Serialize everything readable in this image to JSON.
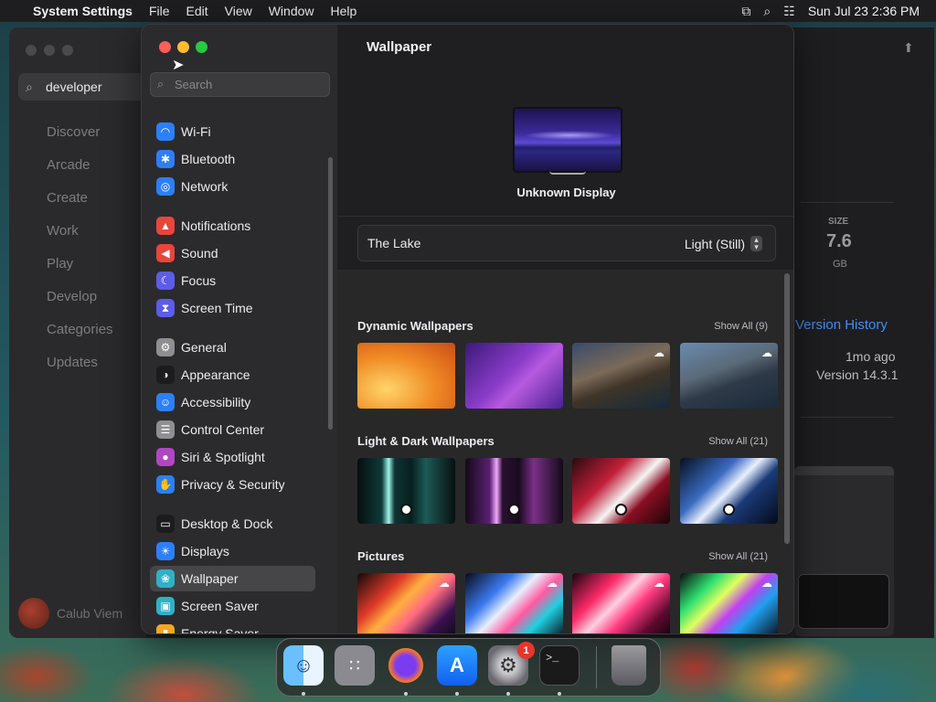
{
  "menubar": {
    "app_name": "System Settings",
    "menus": [
      "File",
      "Edit",
      "View",
      "Window",
      "Help"
    ],
    "datetime": "Sun Jul 23  2:36 PM"
  },
  "appstore": {
    "search_value": "developer",
    "nav": [
      "Discover",
      "Arcade",
      "Create",
      "Work",
      "Play",
      "Develop",
      "Categories",
      "Updates"
    ],
    "user_name": "Calub Viem",
    "size_label": "SIZE",
    "size_value": "7.6",
    "size_unit": "GB",
    "version_history": "Version History",
    "ago": "1mo ago",
    "version": "Version 14.3.1"
  },
  "settings": {
    "search_placeholder": "Search",
    "sidebar": [
      {
        "label": "Wi-Fi",
        "icon": "wifi-icon",
        "color": "#2d7ff9",
        "glyph": "◠"
      },
      {
        "label": "Bluetooth",
        "icon": "bluetooth-icon",
        "color": "#2d7ff9",
        "glyph": "✱"
      },
      {
        "label": "Network",
        "icon": "globe-icon",
        "color": "#2d7ff9",
        "glyph": "◎"
      },
      {
        "label": "Notifications",
        "icon": "bell-icon",
        "color": "#e8453c",
        "glyph": "▲"
      },
      {
        "label": "Sound",
        "icon": "speaker-icon",
        "color": "#e8453c",
        "glyph": "◀"
      },
      {
        "label": "Focus",
        "icon": "moon-icon",
        "color": "#5d5ce6",
        "glyph": "☾"
      },
      {
        "label": "Screen Time",
        "icon": "hourglass-icon",
        "color": "#5d5ce6",
        "glyph": "⧗"
      },
      {
        "label": "General",
        "icon": "gear-icon",
        "color": "#8e8e93",
        "glyph": "⚙"
      },
      {
        "label": "Appearance",
        "icon": "appearance-icon",
        "color": "#1c1c1e",
        "glyph": "◑"
      },
      {
        "label": "Accessibility",
        "icon": "accessibility-icon",
        "color": "#2d7ff9",
        "glyph": "☺"
      },
      {
        "label": "Control Center",
        "icon": "control-center-icon",
        "color": "#8e8e93",
        "glyph": "☰"
      },
      {
        "label": "Siri & Spotlight",
        "icon": "siri-icon",
        "color": "#b146c2",
        "glyph": "●"
      },
      {
        "label": "Privacy & Security",
        "icon": "hand-icon",
        "color": "#2d7ff9",
        "glyph": "✋"
      },
      {
        "label": "Desktop & Dock",
        "icon": "dock-icon",
        "color": "#1c1c1e",
        "glyph": "▭"
      },
      {
        "label": "Displays",
        "icon": "sun-icon",
        "color": "#2d7ff9",
        "glyph": "☀"
      },
      {
        "label": "Wallpaper",
        "icon": "wallpaper-icon",
        "color": "#30b0c7",
        "glyph": "❀"
      },
      {
        "label": "Screen Saver",
        "icon": "screensaver-icon",
        "color": "#30b0c7",
        "glyph": "▣"
      },
      {
        "label": "Energy Saver",
        "icon": "battery-icon",
        "color": "#f5a623",
        "glyph": "▮"
      }
    ],
    "selected": "Wallpaper",
    "content": {
      "title": "Wallpaper",
      "display_name": "Unknown Display",
      "wallpaper_name": "The Lake",
      "mode": "Light (Still)",
      "sections": [
        {
          "title": "Dynamic Wallpapers",
          "show_all": "Show All (9)"
        },
        {
          "title": "Light & Dark Wallpapers",
          "show_all": "Show All (21)"
        },
        {
          "title": "Pictures",
          "show_all": "Show All (21)"
        }
      ]
    }
  },
  "dock": {
    "badge": "1",
    "apps": [
      "Finder",
      "Launchpad",
      "Firefox",
      "App Store",
      "System Settings",
      "Terminal",
      "Trash"
    ]
  }
}
